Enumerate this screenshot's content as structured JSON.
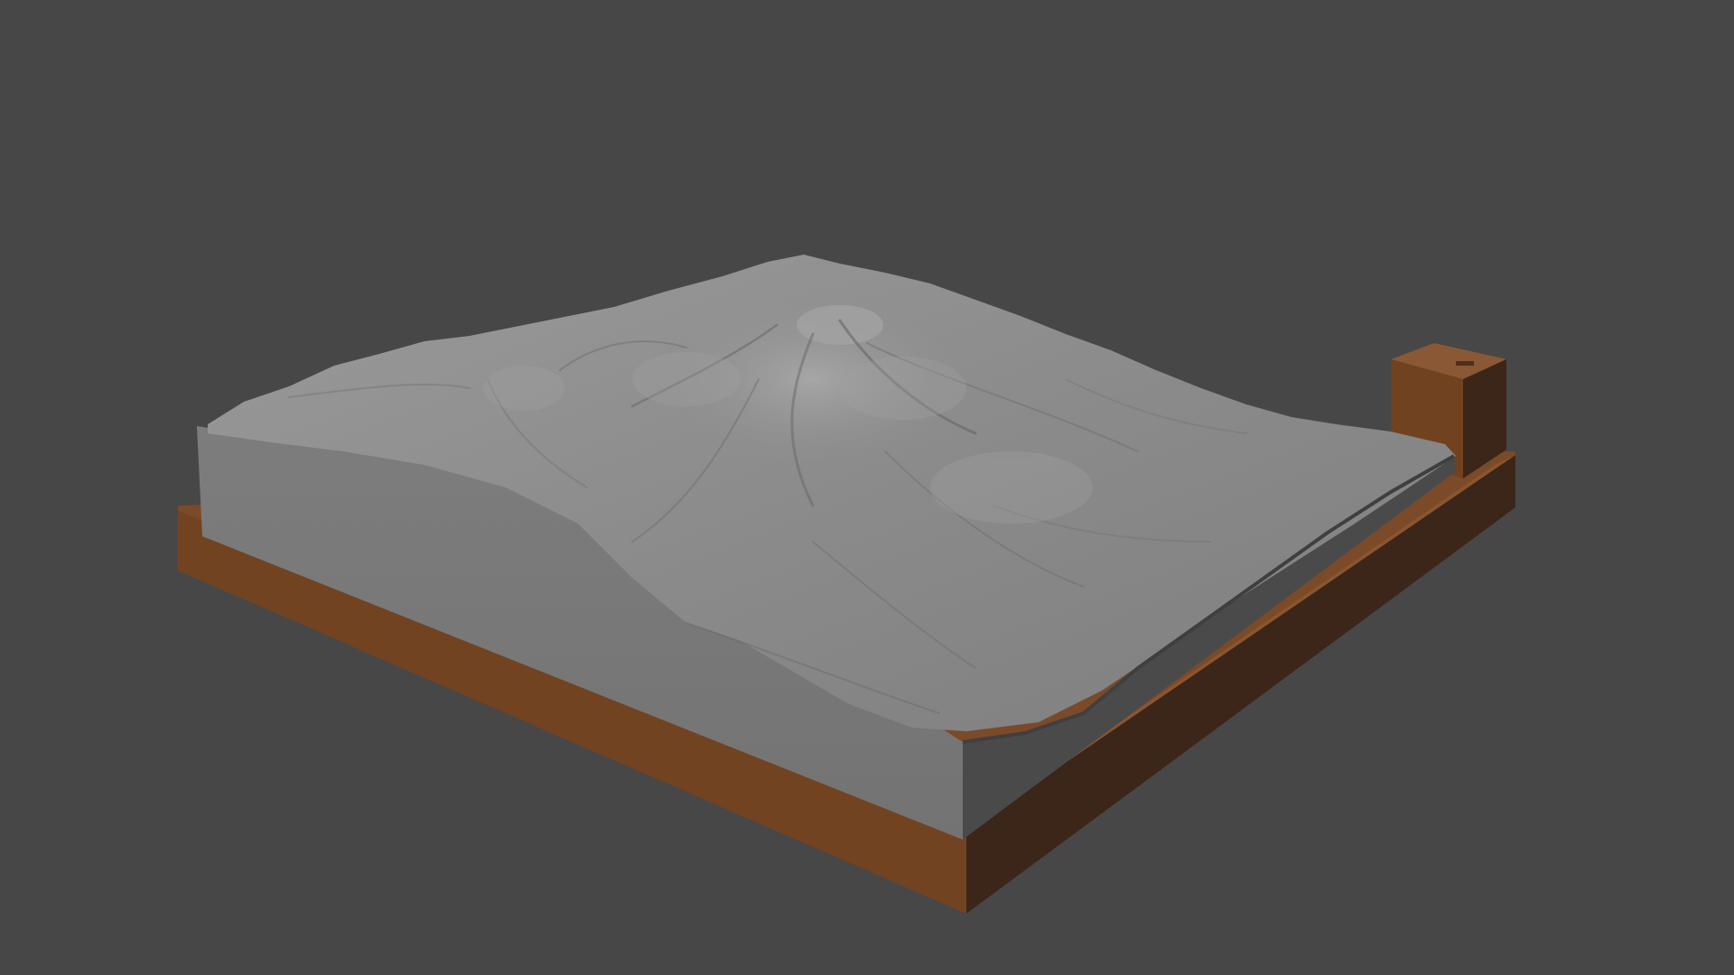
{
  "viewport": {
    "background_color": "#474747",
    "object_type": "terrain-relief-model-on-base",
    "colors": {
      "terrain_top": "#8d8d8d",
      "terrain_light": "#a2a2a2",
      "terrain_shadow": "#5f5f5f",
      "terrain_side_front": "#7a7a7a",
      "terrain_side_right": "#4a4a4a",
      "base_top": "#7b4a28",
      "base_front": "#714321",
      "base_right": "#3b2619",
      "label_block_front": "#70421f",
      "label_block_side": "#3c261a"
    },
    "engraving_text": ""
  }
}
